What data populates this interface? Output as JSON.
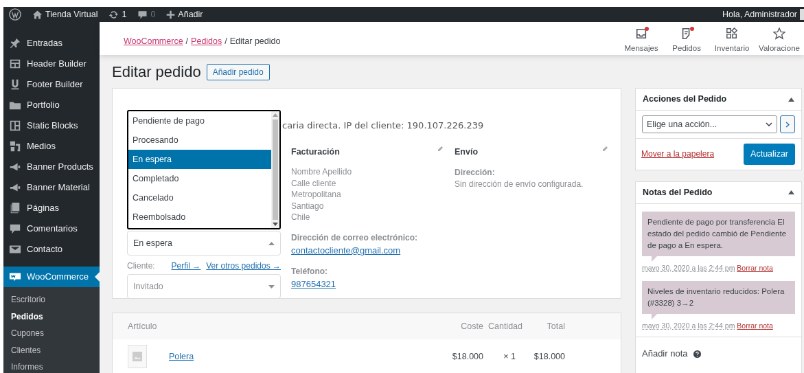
{
  "admin_bar": {
    "site": "Tienda Virtual",
    "updates": "1",
    "comments": "0",
    "new": "Añadir",
    "greeting": "Hola, Administrador"
  },
  "sidebar": {
    "items": [
      {
        "label": "Entradas",
        "selected": false
      },
      {
        "label": "Header Builder",
        "selected": false
      },
      {
        "label": "Footer Builder",
        "selected": false
      },
      {
        "label": "Portfolio",
        "selected": false
      },
      {
        "label": "Static Blocks",
        "selected": false
      },
      {
        "label": "Medios",
        "selected": false
      },
      {
        "label": "Banner Products",
        "selected": false
      },
      {
        "label": "Banner Material",
        "selected": false
      },
      {
        "label": "Páginas",
        "selected": false
      },
      {
        "label": "Comentarios",
        "selected": false
      },
      {
        "label": "Contacto",
        "selected": false
      },
      {
        "label": "WooCommerce",
        "selected": true
      }
    ],
    "submenu": [
      {
        "label": "Escritorio",
        "selected": false
      },
      {
        "label": "Pedidos",
        "selected": true
      },
      {
        "label": "Cupones",
        "selected": false
      },
      {
        "label": "Clientes",
        "selected": false
      },
      {
        "label": "Informes",
        "selected": false
      }
    ]
  },
  "breadcrumb_separator": "/",
  "breadcrumb": [
    {
      "label": "WooCommerce",
      "kind": "link"
    },
    {
      "label": "Pedidos",
      "kind": "link"
    },
    {
      "label": "Editar pedido",
      "kind": "current"
    }
  ],
  "header_tabs": [
    {
      "label": "Mensajes",
      "notification": true
    },
    {
      "label": "Pedidos",
      "notification": true
    },
    {
      "label": "Inventario",
      "notification": false
    },
    {
      "label": "Valoracione",
      "notification": false
    }
  ],
  "page_title": "Editar pedido",
  "add_button": "Añadir pedido",
  "order": {
    "payment_info": "caria directa. IP del cliente: 190.107.226.239",
    "status_options": [
      {
        "label": "Pendiente de pago",
        "selected": false
      },
      {
        "label": "Procesando",
        "selected": false
      },
      {
        "label": "En espera",
        "selected": true
      },
      {
        "label": "Completado",
        "selected": false
      },
      {
        "label": "Cancelado",
        "selected": false
      },
      {
        "label": "Reembolsado",
        "selected": false
      }
    ],
    "status": {
      "value": "En espera",
      "expanded": true
    },
    "customer_label": "Cliente:",
    "profile_link": "Perfil →",
    "other_orders_link": "Ver otros pedidos →",
    "customer": {
      "placeholder": "Invitado"
    },
    "billing": {
      "title": "Facturación",
      "address_lines": [
        "Nombre Apellido",
        "Calle cliente",
        "Metropolitana",
        "Santiago",
        "Chile"
      ],
      "email_label": "Dirección de correo electrónico:",
      "email": "contactocliente@gmail.com",
      "phone_label": "Teléfono:",
      "phone": "987654321"
    },
    "shipping": {
      "title": "Envío",
      "address_label": "Dirección:",
      "address": "Sin dirección de envío configurada."
    }
  },
  "items_table": {
    "columns": [
      "Artículo",
      "Coste",
      "Cantidad",
      "Total"
    ],
    "rows": [
      {
        "name": "Polera",
        "cost": "$18.000",
        "quantity": "× 1",
        "total": "$18.000"
      }
    ]
  },
  "order_actions": {
    "title": "Acciones del Pedido",
    "select": {
      "value": "Elige una acción..."
    },
    "trash_link": "Mover a la papelera",
    "update_button": "Actualizar"
  },
  "order_notes": {
    "title": "Notas del Pedido",
    "notes": [
      {
        "text": "Pendiente de pago por transferencia El estado del pedido cambió de Pendiente de pago a En espera.",
        "date": "mayo 30, 2020 a las 2:44 pm",
        "delete": "Borrar nota"
      },
      {
        "text": "Niveles de inventario reducidos: Polera (#3328) 3→2",
        "date": "mayo 30, 2020 a las 2:44 pm",
        "delete": "Borrar nota"
      }
    ],
    "add_note_label": "Añadir nota"
  }
}
